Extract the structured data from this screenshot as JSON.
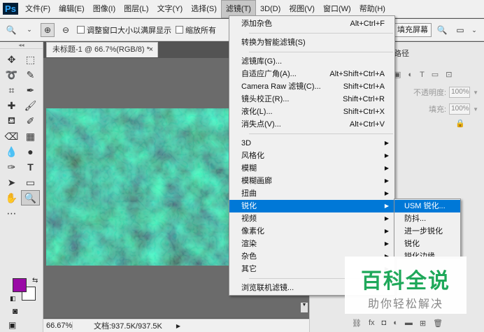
{
  "app": {
    "logo": "Ps"
  },
  "menubar": {
    "items": [
      "文件(F)",
      "编辑(E)",
      "图像(I)",
      "图层(L)",
      "文字(Y)",
      "选择(S)",
      "滤镜(T)",
      "3D(D)",
      "视图(V)",
      "窗口(W)",
      "帮助(H)"
    ],
    "active_index": 6
  },
  "options": {
    "resize_window": "调整窗口大小以满屏显示",
    "zoom_all": "缩放所有",
    "fill_screen": "填充屏幕"
  },
  "document": {
    "tab_title": "未标题-1 @ 66.7%(RGB/8) *",
    "close": "×"
  },
  "status": {
    "zoom": "66.67%",
    "doc_info": "文档:937.5K/937.5K"
  },
  "right_panel": {
    "tab": "路径",
    "opacity_label": "不透明度:",
    "opacity_value": "100%",
    "fill_label": "填充:",
    "fill_value": "100%"
  },
  "filter_menu": {
    "groups": [
      [
        {
          "label": "添加杂色",
          "shortcut": "Alt+Ctrl+F"
        }
      ],
      [
        {
          "label": "转换为智能滤镜(S)",
          "shortcut": ""
        }
      ],
      [
        {
          "label": "滤镜库(G)...",
          "shortcut": ""
        },
        {
          "label": "自适应广角(A)...",
          "shortcut": "Alt+Shift+Ctrl+A"
        },
        {
          "label": "Camera Raw 滤镜(C)...",
          "shortcut": "Shift+Ctrl+A"
        },
        {
          "label": "镜头校正(R)...",
          "shortcut": "Shift+Ctrl+R"
        },
        {
          "label": "液化(L)...",
          "shortcut": "Shift+Ctrl+X"
        },
        {
          "label": "消失点(V)...",
          "shortcut": "Alt+Ctrl+V"
        }
      ],
      [
        {
          "label": "3D",
          "submenu": true
        },
        {
          "label": "风格化",
          "submenu": true
        },
        {
          "label": "模糊",
          "submenu": true
        },
        {
          "label": "模糊画廊",
          "submenu": true
        },
        {
          "label": "扭曲",
          "submenu": true
        },
        {
          "label": "锐化",
          "submenu": true,
          "highlight": true
        },
        {
          "label": "视频",
          "submenu": true
        },
        {
          "label": "像素化",
          "submenu": true
        },
        {
          "label": "渲染",
          "submenu": true
        },
        {
          "label": "杂色",
          "submenu": true
        },
        {
          "label": "其它",
          "submenu": true
        }
      ],
      [
        {
          "label": "浏览联机滤镜...",
          "shortcut": ""
        }
      ]
    ]
  },
  "sharpen_submenu": [
    {
      "label": "USM 锐化...",
      "highlight": true
    },
    {
      "label": "防抖..."
    },
    {
      "label": "进一步锐化"
    },
    {
      "label": "锐化"
    },
    {
      "label": "锐化边缘"
    }
  ],
  "colors": {
    "foreground": "#9a0aa6",
    "background": "#ffffff",
    "menu_highlight": "#0078d7"
  },
  "watermark": {
    "title": "百科全说",
    "subtitle": "助你轻松解决"
  }
}
